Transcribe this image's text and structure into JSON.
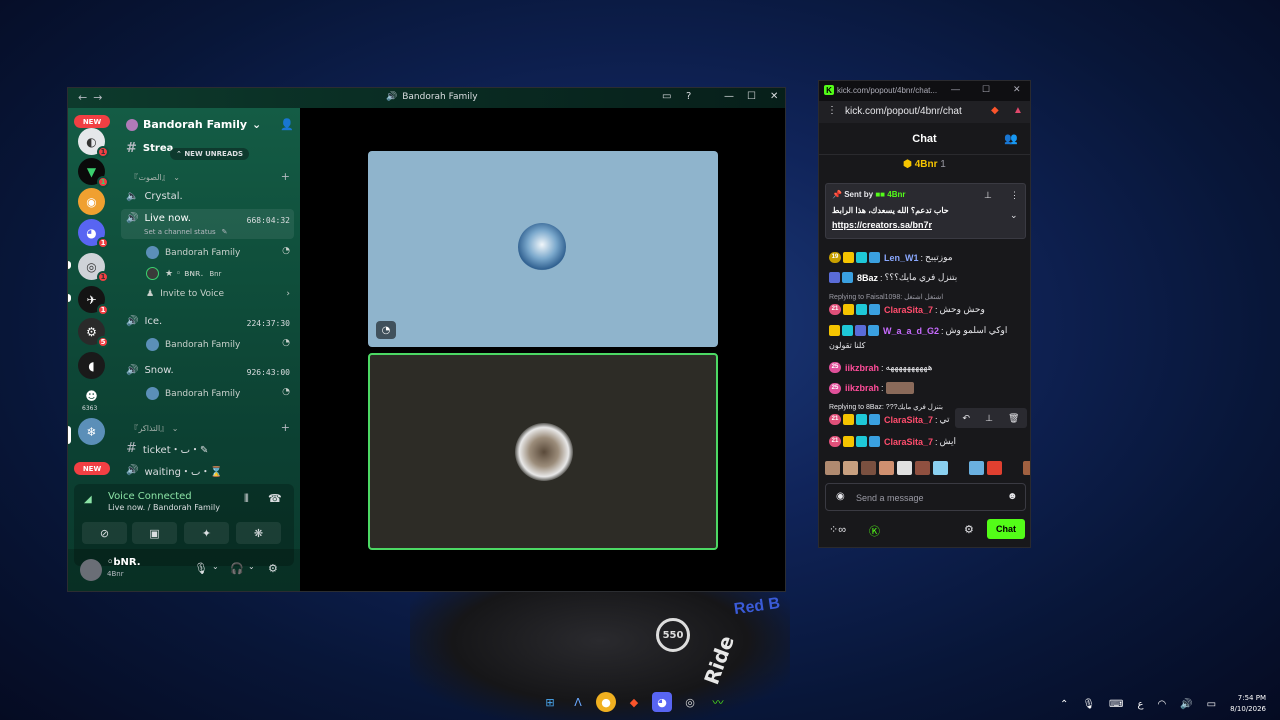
{
  "discord": {
    "title": "Bandorah Family",
    "server_name": "Bandorah Family",
    "new_unreads": "NEW UNREADS",
    "new_pill": "NEW",
    "channels": {
      "stream": "Strea...",
      "cat_voice": "『الصوت』",
      "crystal": "Crystal.",
      "live": "Live now.",
      "live_timer": "668:04:32",
      "live_status": "Set a channel status",
      "member1": "Bandorah Family",
      "member2": "★ ◦ ʙɴʀ.",
      "member2_tag": "Bnr",
      "invite": "Invite to Voice",
      "ice": "Ice.",
      "ice_timer": "224:37:30",
      "ice_member": "Bandorah Family",
      "snow": "Snow.",
      "snow_timer": "926:43:00",
      "snow_member": "Bandorah Family",
      "cat_ticket": "『التذاكر』",
      "ticket": "ticket・ٮ・✎",
      "waiting": "waiting・ٮ・⌛"
    },
    "badges": [
      "1",
      "1",
      "1",
      "1",
      "1",
      "1",
      "5"
    ],
    "server_count": "6363",
    "voice": {
      "title": "Voice Connected",
      "sub": "Live now. / Bandorah Family"
    },
    "user": {
      "name": "◦bNR.",
      "status": "4Bnr"
    }
  },
  "kick": {
    "window_title": "kick.com/popout/4bnr/chat...",
    "url": "kick.com/popout/4bnr/chat",
    "header": "Chat",
    "viewers_name": "4Bnr",
    "viewers_count": "1",
    "pinned": {
      "sent_by": "Sent by",
      "sender": "4Bnr",
      "message": "حاب تدعم؟ الله يسعدك، هذا الرابط",
      "link": "https://creators.sa/bn7r"
    },
    "messages": [
      {
        "level": "19",
        "user": "Len_W1",
        "color": "#8aa8ff",
        "text": "موزتيبح"
      },
      {
        "level": "",
        "user": "8Baz",
        "color": "#ffffff",
        "text": "بتنزل فري مايك؟؟؟"
      },
      {
        "level": "21",
        "user": "ClaraSita_7",
        "color": "#ff4d6d",
        "text": "وحش وحش"
      },
      {
        "level": "",
        "user": "W_a_a_d_G2",
        "color": "#c86bff",
        "text": "اوكي اسلمو وش"
      },
      {
        "level": "25",
        "user": "iikzbrah",
        "color": "#ff4d9a",
        "text": "ههههههههههه"
      },
      {
        "level": "25",
        "user": "iikzbrah",
        "color": "#ff4d9a",
        "text": ""
      },
      {
        "level": "21",
        "user": "ClaraSita_7",
        "color": "#ff4d6d",
        "text": "تي"
      },
      {
        "level": "21",
        "user": "ClaraSita_7",
        "color": "#ff4d6d",
        "text": "ايش"
      }
    ],
    "reply1": "Replying to Faisal1098: اشتغل اشتغل",
    "reply2": "Replying to 8Baz: ???بتنزل فري مايك",
    "cont_line": "كلنا تقولون",
    "input_placeholder": "Send a message",
    "chat_button": "Chat"
  },
  "clock": {
    "time": "7:54 PM",
    "date": "8/10/2026"
  },
  "tray_lang": "ع",
  "wallpaper_brand": "Red B",
  "wallpaper_ring": "550",
  "wallpaper_word": "Ride"
}
